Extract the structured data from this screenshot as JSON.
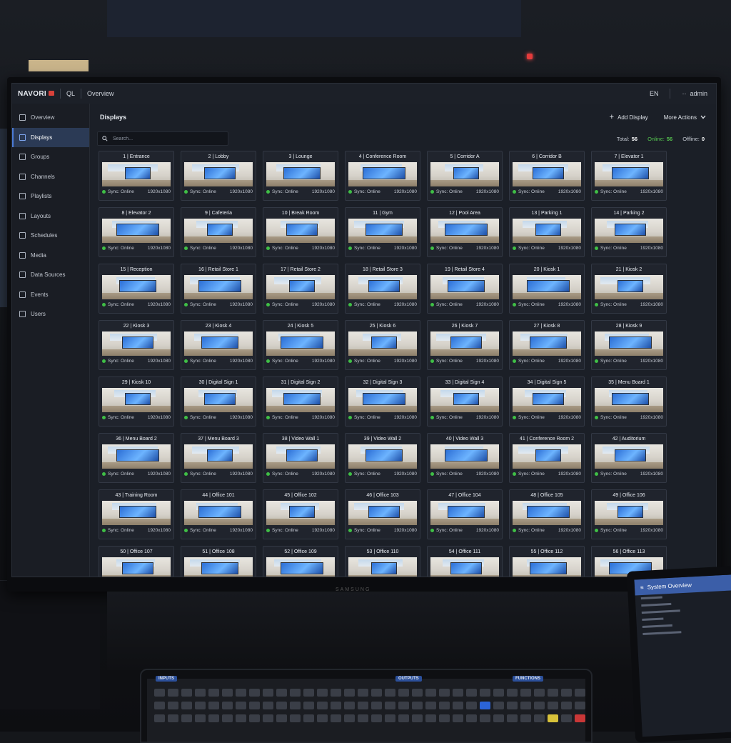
{
  "environment": {
    "sticker_text": "",
    "monitor_brand": "SAMSUNG"
  },
  "app": {
    "brand": "NAVORI",
    "product": "QL",
    "breadcrumb": "Overview",
    "language": "EN",
    "user": "admin"
  },
  "sidebar": {
    "items": [
      {
        "label": "Overview",
        "icon": "grid-icon"
      },
      {
        "label": "Displays",
        "icon": "monitor-icon"
      },
      {
        "label": "Groups",
        "icon": "groups-icon"
      },
      {
        "label": "Channels",
        "icon": "channels-icon"
      },
      {
        "label": "Playlists",
        "icon": "playlist-icon"
      },
      {
        "label": "Layouts",
        "icon": "layout-icon"
      },
      {
        "label": "Schedules",
        "icon": "calendar-icon"
      },
      {
        "label": "Media",
        "icon": "image-icon"
      },
      {
        "label": "Data Sources",
        "icon": "database-icon"
      },
      {
        "label": "Events",
        "icon": "bolt-icon"
      },
      {
        "label": "Users",
        "icon": "user-icon"
      }
    ],
    "active_index": 1
  },
  "main": {
    "title": "Displays",
    "add_label": "Add Display",
    "more_label": "More Actions",
    "search_placeholder": "Search...",
    "stats": {
      "total_label": "Total:",
      "total": "56",
      "online_label": "Online:",
      "online": "56",
      "offline_label": "Offline:",
      "offline": "0"
    }
  },
  "displays": [
    "1 | Entrance",
    "2 | Lobby",
    "3 | Lounge",
    "4 | Conference Room",
    "5 | Corridor A",
    "6 | Corridor B",
    "7 | Elevator 1",
    "8 | Elevator 2",
    "9 | Cafeteria",
    "10 | Break Room",
    "11 | Gym",
    "12 | Pool Area",
    "13 | Parking 1",
    "14 | Parking 2",
    "15 | Reception",
    "16 | Retail Store 1",
    "17 | Retail Store 2",
    "18 | Retail Store 3",
    "19 | Retail Store 4",
    "20 | Kiosk 1",
    "21 | Kiosk 2",
    "22 | Kiosk 3",
    "23 | Kiosk 4",
    "24 | Kiosk 5",
    "25 | Kiosk 6",
    "26 | Kiosk 7",
    "27 | Kiosk 8",
    "28 | Kiosk 9",
    "29 | Kiosk 10",
    "30 | Digital Sign 1",
    "31 | Digital Sign 2",
    "32 | Digital Sign 3",
    "33 | Digital Sign 4",
    "34 | Digital Sign 5",
    "35 | Menu Board 1",
    "36 | Menu Board 2",
    "37 | Menu Board 3",
    "38 | Video Wall 1",
    "39 | Video Wall 2",
    "40 | Video Wall 3",
    "41 | Conference Room 2",
    "42 | Auditorium",
    "43 | Training Room",
    "44 | Office 101",
    "45 | Office 102",
    "46 | Office 103",
    "47 | Office 104",
    "48 | Office 105",
    "49 | Office 106",
    "50 | Office 107",
    "51 | Office 108",
    "52 | Office 109",
    "53 | Office 110",
    "54 | Office 111",
    "55 | Office 112",
    "56 | Office 113"
  ],
  "display_status": "Sync: Online",
  "display_resolution": "1920x1080",
  "colors": {
    "accent": "#4b7bd6",
    "online": "#3fbf46",
    "brand_red": "#d9413a"
  },
  "tablet": {
    "title": "System Overview"
  },
  "console": {
    "inputs_label": "INPUTS",
    "outputs_label": "OUTPUTS",
    "functions_label": "FUNCTIONS"
  }
}
